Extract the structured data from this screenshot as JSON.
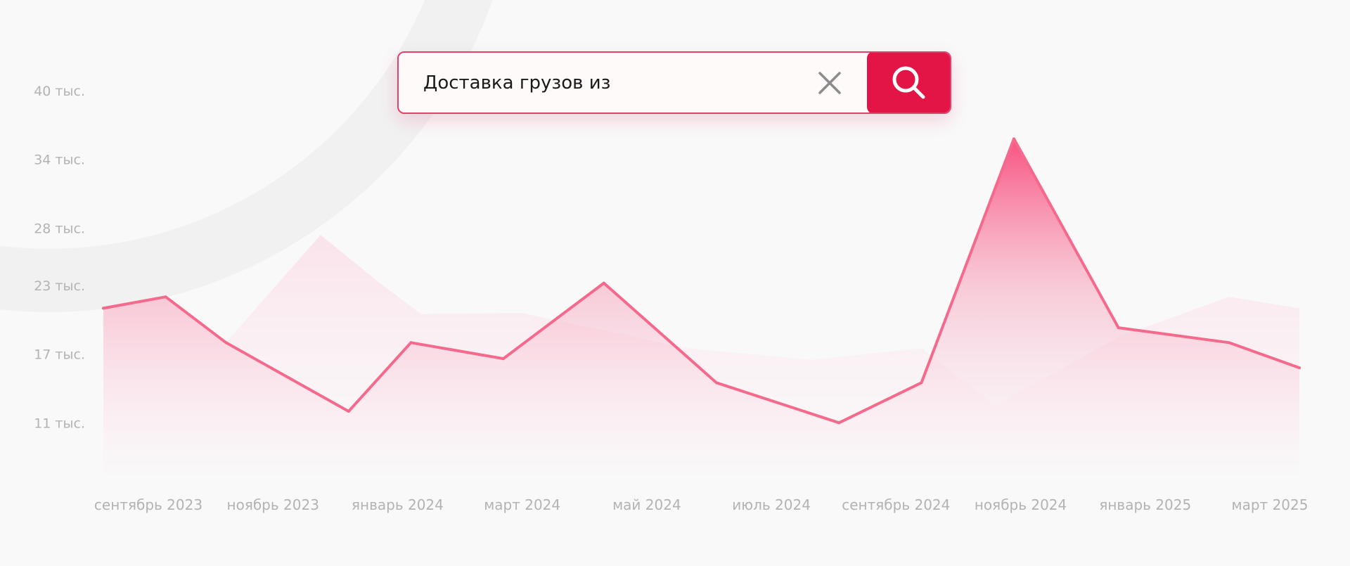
{
  "search": {
    "query": "Доставка грузов из",
    "clear_icon": "close-icon",
    "submit_icon": "search-icon"
  },
  "colors": {
    "accent": "#e31446",
    "line": "#f56a8c",
    "area": "#f7a6bd",
    "tick_text": "#b3b3b3"
  },
  "chart_data": {
    "type": "line",
    "y_ticks": [
      "40 тыс.",
      "34 тыс.",
      "28 тыс.",
      "23 тыс.",
      "17 тыс.",
      "11 тыс."
    ],
    "y_tick_values": [
      40000,
      34000,
      28000,
      23000,
      17000,
      11000
    ],
    "x_ticks": [
      "сентябрь 2023",
      "ноябрь 2023",
      "январь 2024",
      "март 2024",
      "май 2024",
      "июль 2024",
      "сентябрь 2024",
      "ноябрь 2024",
      "январь 2025",
      "март 2025"
    ],
    "ylim": [
      5000,
      40000
    ],
    "grid": false,
    "series": [
      {
        "values": [
          [
            "2023-08-15",
            21000
          ],
          [
            "2023-09-15",
            22000
          ],
          [
            "2023-10-15",
            18000
          ],
          [
            "2023-12-15",
            12000
          ],
          [
            "2024-01-15",
            18000
          ],
          [
            "2024-03-01",
            16600
          ],
          [
            "2024-04-20",
            23200
          ],
          [
            "2024-06-15",
            14500
          ],
          [
            "2024-08-15",
            11000
          ],
          [
            "2024-09-25",
            14500
          ],
          [
            "2024-11-10",
            35800
          ],
          [
            "2025-01-01",
            19300
          ],
          [
            "2025-02-25",
            18000
          ],
          [
            "2025-04-01",
            15800
          ]
        ]
      },
      {
        "values": [
          [
            "2023-08-15",
            21000
          ],
          [
            "2023-09-15",
            22000
          ],
          [
            "2023-10-15",
            18000
          ],
          [
            "2023-12-01",
            27400
          ],
          [
            "2024-01-01",
            23000
          ],
          [
            "2024-01-20",
            20500
          ],
          [
            "2024-03-10",
            20600
          ],
          [
            "2024-06-01",
            17500
          ],
          [
            "2024-08-01",
            16500
          ],
          [
            "2024-09-25",
            17500
          ],
          [
            "2024-11-01",
            12500
          ],
          [
            "2025-01-01",
            18500
          ],
          [
            "2025-02-25",
            22000
          ],
          [
            "2025-04-01",
            21000
          ]
        ]
      }
    ]
  }
}
